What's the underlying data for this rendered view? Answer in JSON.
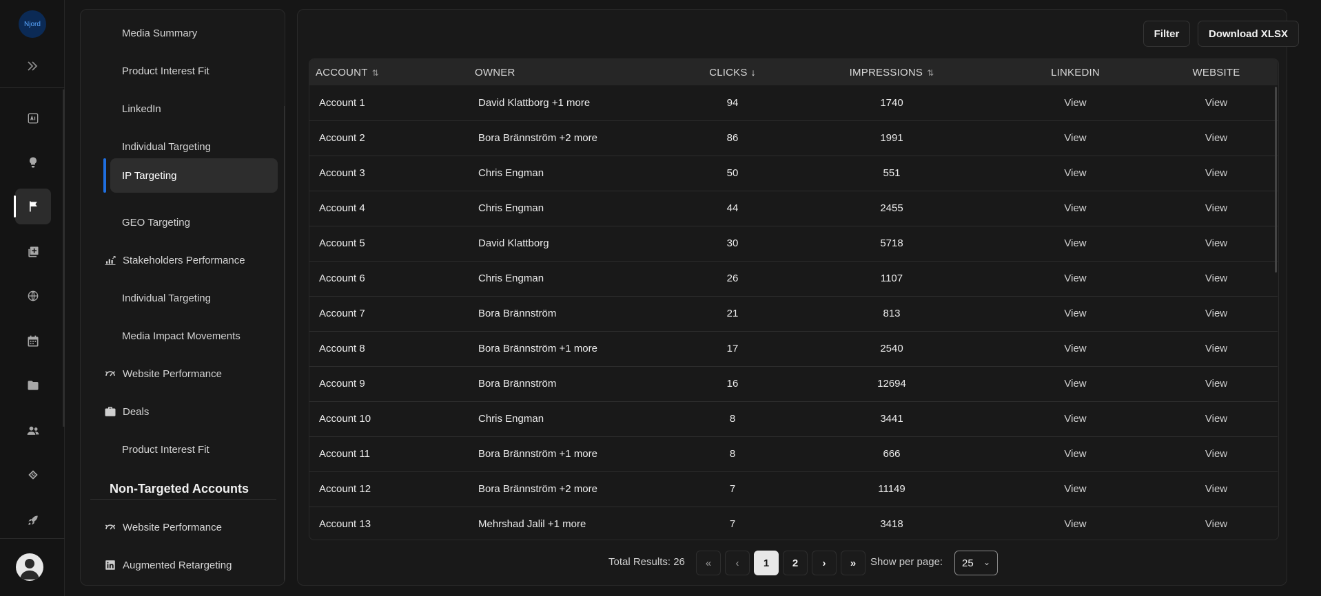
{
  "rail": {
    "logo_text": "Njord"
  },
  "subnav": {
    "items": [
      {
        "label": "Media Summary"
      },
      {
        "label": "Product Interest Fit"
      },
      {
        "label": "LinkedIn"
      },
      {
        "label": "Individual Targeting"
      },
      {
        "label": "IP Targeting"
      },
      {
        "label": "GEO Targeting"
      },
      {
        "label": "Stakeholders Performance"
      },
      {
        "label": "Individual Targeting"
      },
      {
        "label": "Media Impact Movements"
      },
      {
        "label": "Website Performance"
      },
      {
        "label": "Deals"
      },
      {
        "label": "Product Interest Fit"
      }
    ],
    "section_title": "Non-Targeted Accounts",
    "section_items": [
      {
        "label": "Website Performance"
      },
      {
        "label": "Augmented Retargeting"
      }
    ]
  },
  "toolbar": {
    "filter_label": "Filter",
    "download_label": "Download XLSX"
  },
  "table": {
    "headers": {
      "account": "ACCOUNT",
      "owner": "OWNER",
      "clicks": "CLICKS",
      "impressions": "IMPRESSIONS",
      "linkedin": "LINKEDIN",
      "website": "WEBSITE"
    },
    "rows": [
      {
        "account": "Account 1",
        "owner": "David Klattborg +1 more",
        "clicks": "94",
        "impressions": "1740",
        "linkedin": "View",
        "website": "View"
      },
      {
        "account": "Account 2",
        "owner": "Bora Brännström +2 more",
        "clicks": "86",
        "impressions": "1991",
        "linkedin": "View",
        "website": "View"
      },
      {
        "account": "Account 3",
        "owner": "Chris Engman",
        "clicks": "50",
        "impressions": "551",
        "linkedin": "View",
        "website": "View"
      },
      {
        "account": "Account 4",
        "owner": "Chris Engman",
        "clicks": "44",
        "impressions": "2455",
        "linkedin": "View",
        "website": "View"
      },
      {
        "account": "Account 5",
        "owner": "David Klattborg",
        "clicks": "30",
        "impressions": "5718",
        "linkedin": "View",
        "website": "View"
      },
      {
        "account": "Account 6",
        "owner": "Chris Engman",
        "clicks": "26",
        "impressions": "1107",
        "linkedin": "View",
        "website": "View"
      },
      {
        "account": "Account 7",
        "owner": "Bora Brännström",
        "clicks": "21",
        "impressions": "813",
        "linkedin": "View",
        "website": "View"
      },
      {
        "account": "Account 8",
        "owner": "Bora Brännström +1 more",
        "clicks": "17",
        "impressions": "2540",
        "linkedin": "View",
        "website": "View"
      },
      {
        "account": "Account 9",
        "owner": "Bora Brännström",
        "clicks": "16",
        "impressions": "12694",
        "linkedin": "View",
        "website": "View"
      },
      {
        "account": "Account 10",
        "owner": "Chris Engman",
        "clicks": "8",
        "impressions": "3441",
        "linkedin": "View",
        "website": "View"
      },
      {
        "account": "Account 11",
        "owner": "Bora Brännström +1 more",
        "clicks": "8",
        "impressions": "666",
        "linkedin": "View",
        "website": "View"
      },
      {
        "account": "Account 12",
        "owner": "Bora Brännström +2 more",
        "clicks": "7",
        "impressions": "11149",
        "linkedin": "View",
        "website": "View"
      },
      {
        "account": "Account 13",
        "owner": "Mehrshad Jalil +1 more",
        "clicks": "7",
        "impressions": "3418",
        "linkedin": "View",
        "website": "View"
      }
    ]
  },
  "pagination": {
    "total_label": "Total Results: 26",
    "pages": [
      "1",
      "2"
    ],
    "current_page": "1",
    "show_label": "Show per page:",
    "per_page": "25"
  },
  "colors": {
    "accent": "#1f6fe0",
    "background": "#161616",
    "panel": "#191919"
  }
}
